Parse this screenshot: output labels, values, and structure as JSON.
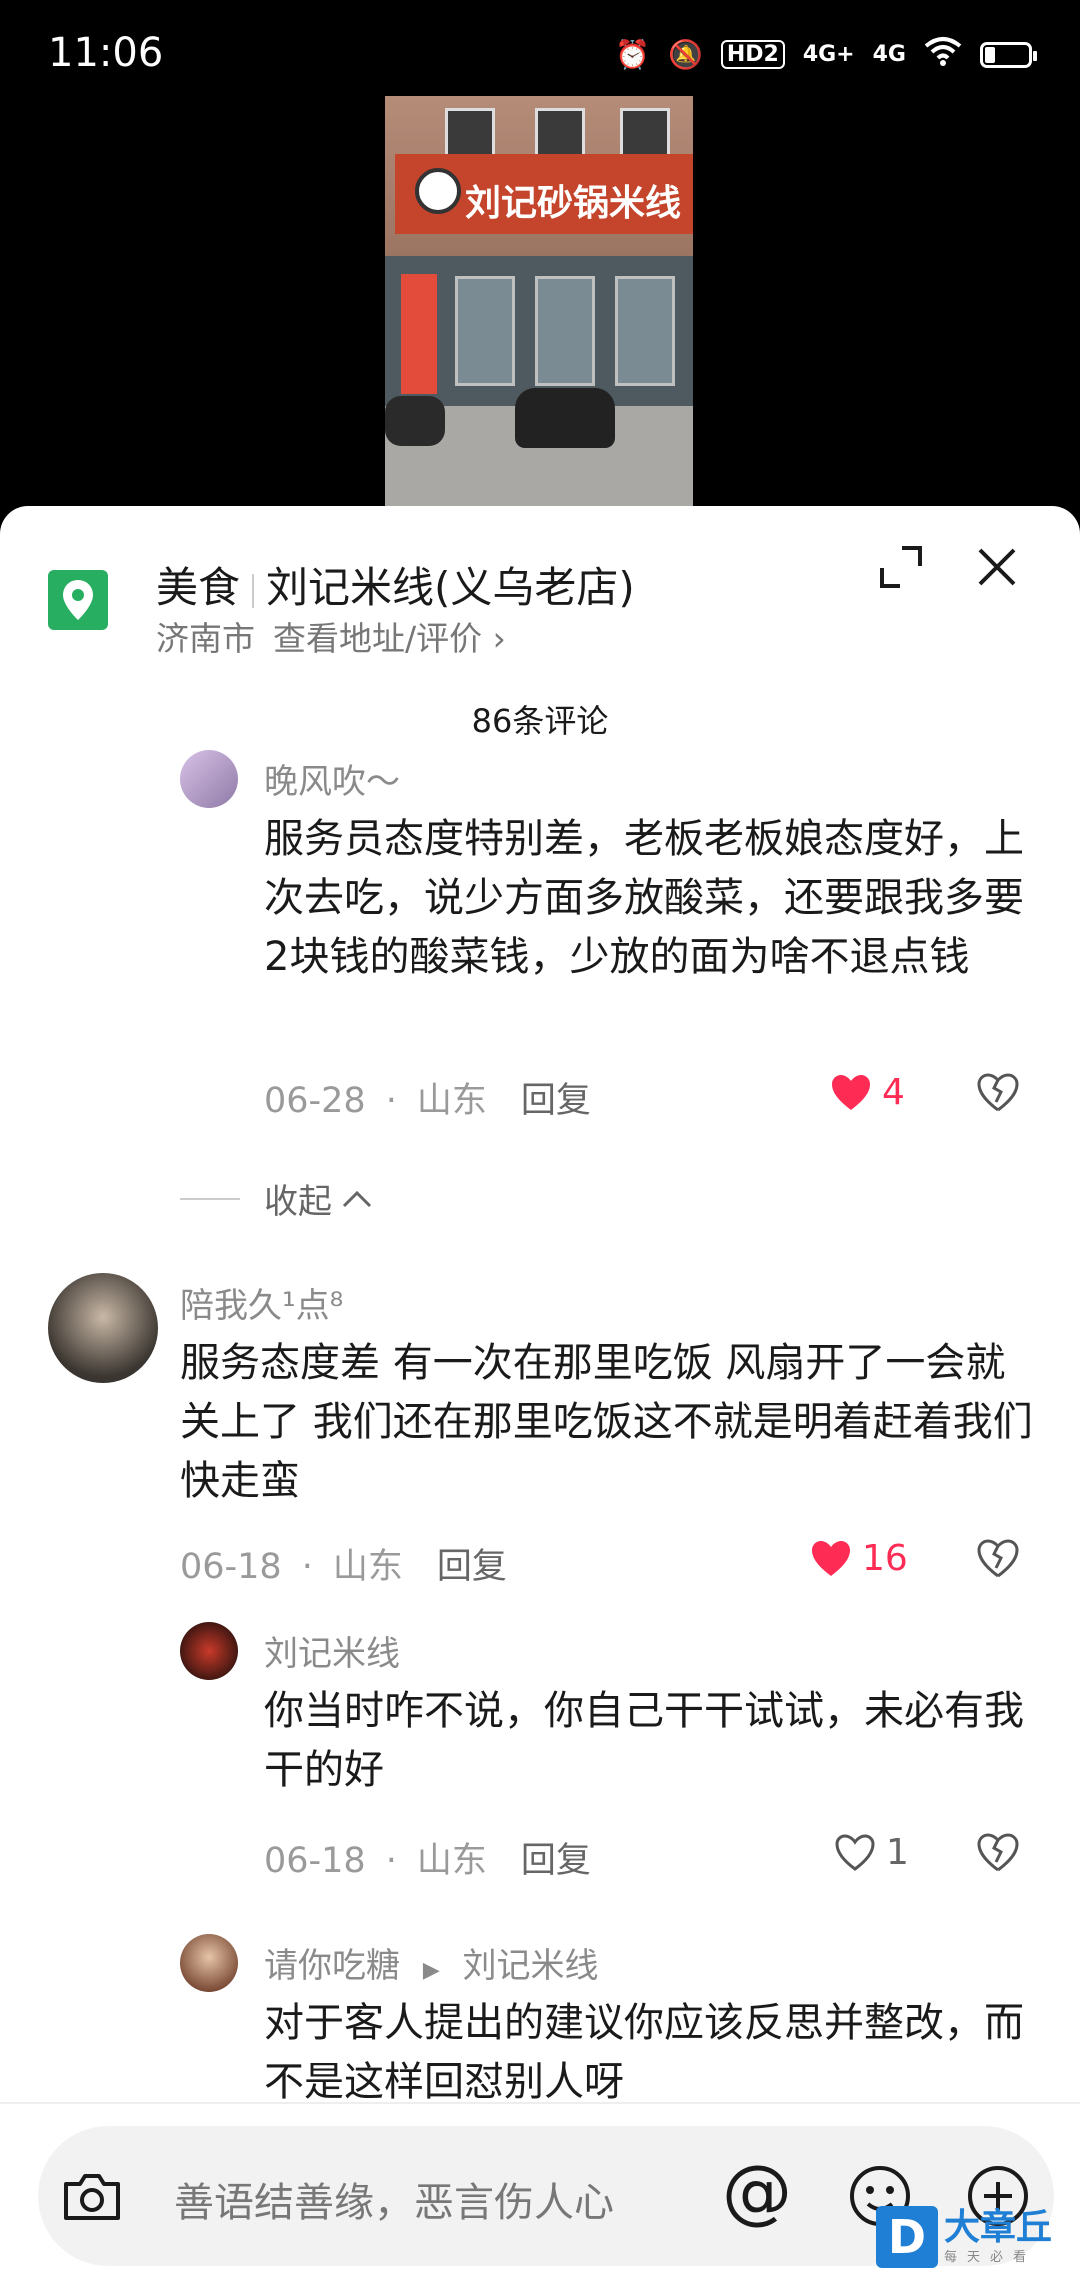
{
  "status_bar": {
    "time": "11:06",
    "net1": "4G+",
    "net2": "4G",
    "hd": "HD2"
  },
  "video": {
    "sign_text": "刘记砂锅米线"
  },
  "location": {
    "category": "美食",
    "name": "刘记米线(义乌老店)",
    "city": "济南市",
    "link": "查看地址/评价",
    "chevron": "›"
  },
  "comments_header": {
    "count_label": "86条评论"
  },
  "comments": [
    {
      "user": "晚风吹～",
      "text": "服务员态度特别差，老板老板娘态度好，上次去吃，说少方面多放酸菜，还要跟我多要2块钱的酸菜钱，少放的面为啥不退点钱",
      "date": "06-28",
      "region": "山东",
      "reply": "回复",
      "likes": "4",
      "liked": true
    },
    {
      "user": "陪我久¹点⁸",
      "text": "服务态度差  有一次在那里吃饭 风扇开了一会就关上了 我们还在那里吃饭这不就是明着赶着我们快走蛮",
      "date": "06-18",
      "region": "山东",
      "reply": "回复",
      "likes": "16",
      "liked": true
    },
    {
      "user": "刘记米线",
      "text": "你当时咋不说，你自己干干试试，未必有我干的好",
      "date": "06-18",
      "region": "山东",
      "reply": "回复",
      "likes": "1",
      "liked": false
    },
    {
      "user": "请你吃糖",
      "reply_to": "刘记米线",
      "text": "对于客人提出的建议你应该反思并整改，而不是这样回怼别人呀"
    }
  ],
  "collapse_label": "收起",
  "input": {
    "placeholder": "善语结善缘，恶言伤人心",
    "at": "@"
  },
  "watermark": {
    "logo": "D",
    "title": "大章丘",
    "sub": "每天必看"
  },
  "colors": {
    "like_red": "#fe2c55",
    "location_green": "#27ae60"
  }
}
